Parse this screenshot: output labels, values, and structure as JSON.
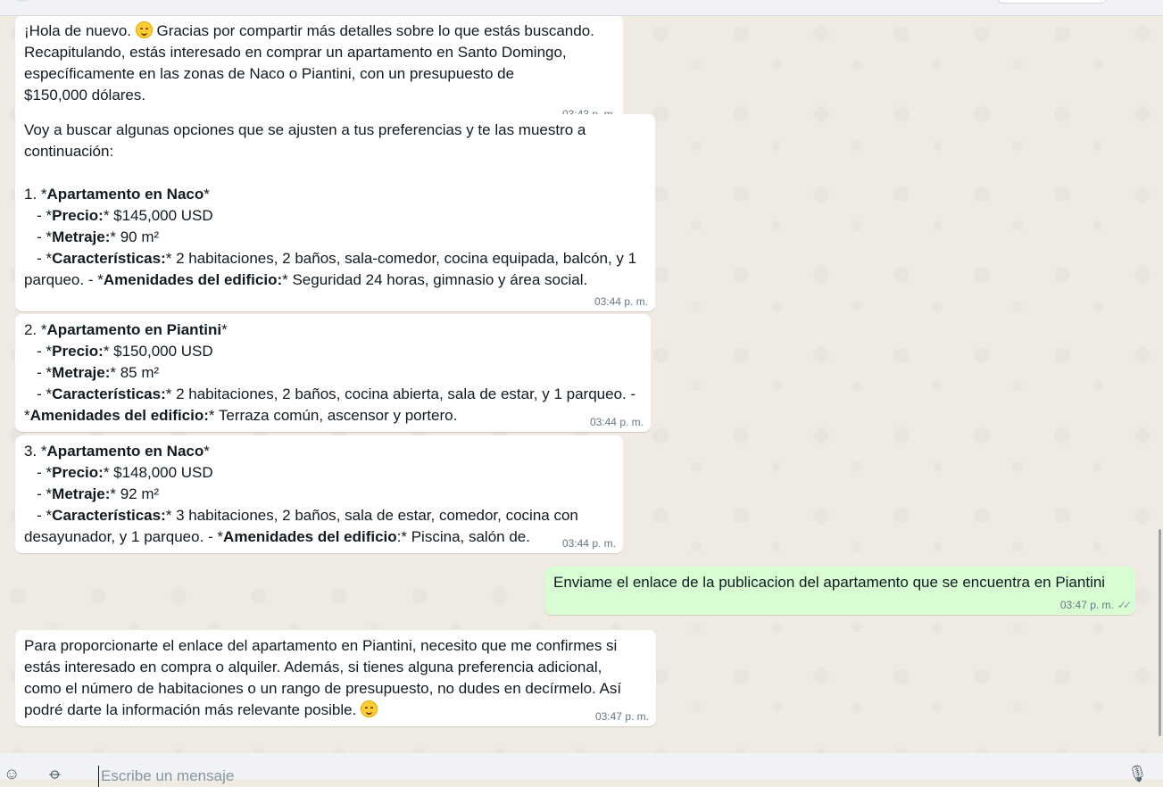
{
  "colors": {
    "chat_bg": "#efeae2",
    "incoming": "#ffffff",
    "outgoing": "#d9fdd3",
    "time": "#667781"
  },
  "messages": [
    {
      "lines": [
        [
          {
            "t": "¡Hola de nuevo. "
          },
          {
            "emoji": "smiling-face-emoji"
          },
          {
            "t": " Gracias por compartir más detalles sobre lo que estás buscando."
          }
        ],
        [
          {
            "t": "Recapitulando, estás interesado en comprar un apartamento en Santo Domingo,"
          }
        ],
        [
          {
            "t": "específicamente en las zonas de Naco o Piantini, con un presupuesto de"
          }
        ],
        [
          {
            "t": "$150,000 dólares."
          }
        ]
      ],
      "time": "03:43 p. m."
    },
    {
      "lines": [
        [
          {
            "t": "Voy a buscar algunas opciones que se ajusten a tus preferencias y te las muestro a"
          }
        ],
        [
          {
            "t": "continuación:"
          }
        ],
        [
          {
            "t": ""
          }
        ],
        [
          {
            "t": "1. *"
          },
          {
            "b": "Apartamento en Naco"
          },
          {
            "t": "*"
          }
        ],
        [
          {
            "t": "   - *"
          },
          {
            "b": "Precio:"
          },
          {
            "t": "* $145,000 USD"
          }
        ],
        [
          {
            "t": "   - *"
          },
          {
            "b": "Metraje:"
          },
          {
            "t": "* 90 m²"
          }
        ],
        [
          {
            "t": "   - *"
          },
          {
            "b": "Características:"
          },
          {
            "t": "* 2 habitaciones, 2 baños, sala-comedor, cocina equipada, balcón, y 1"
          }
        ],
        [
          {
            "t": "parqueo. - *"
          },
          {
            "b": "Amenidades del edificio:"
          },
          {
            "t": "* Seguridad 24 horas, gimnasio y área social."
          }
        ]
      ],
      "time": "03:44 p. m."
    },
    {
      "lines": [
        [
          {
            "t": "2. *"
          },
          {
            "b": "Apartamento en Piantini"
          },
          {
            "t": "*"
          }
        ],
        [
          {
            "t": "   - *"
          },
          {
            "b": "Precio:"
          },
          {
            "t": "* $150,000 USD"
          }
        ],
        [
          {
            "t": "   - *"
          },
          {
            "b": "Metraje:"
          },
          {
            "t": "* 85 m²"
          }
        ],
        [
          {
            "t": "   - *"
          },
          {
            "b": "Características:"
          },
          {
            "t": "* 2 habitaciones, 2 baños, cocina abierta, sala de estar, y 1 parqueo. -"
          }
        ],
        [
          {
            "t": "*"
          },
          {
            "b": "Amenidades del edificio:"
          },
          {
            "t": "* Terraza común, ascensor y portero."
          }
        ]
      ],
      "time": "03:44 p. m."
    },
    {
      "lines": [
        [
          {
            "t": "3. *"
          },
          {
            "b": "Apartamento en Naco"
          },
          {
            "t": "*"
          }
        ],
        [
          {
            "t": "   - *"
          },
          {
            "b": "Precio:"
          },
          {
            "t": "* $148,000 USD"
          }
        ],
        [
          {
            "t": "   - *"
          },
          {
            "b": "Metraje:"
          },
          {
            "t": "* 92 m²"
          }
        ],
        [
          {
            "t": "   - *"
          },
          {
            "b": "Características:"
          },
          {
            "t": "* 3 habitaciones, 2 baños, sala de estar, comedor, cocina con"
          }
        ],
        [
          {
            "t": "desayunador, y 1 parqueo. - *"
          },
          {
            "b": "Amenidades del edificio"
          },
          {
            "t": ":* Piscina, salón de."
          }
        ]
      ],
      "time": "03:44 p. m."
    },
    {
      "outgoing": true,
      "lines": [
        [
          {
            "t": "Enviame el enlace de la publicacion del apartamento que se encuentra en Piantini"
          }
        ]
      ],
      "time": "03:47 p. m.",
      "status_icon": "double-check-icon"
    },
    {
      "lines": [
        [
          {
            "t": "Para proporcionarte el enlace del apartamento en Piantini, necesito que me confirmes si"
          }
        ],
        [
          {
            "t": "estás interesado en compra o alquiler. Además, si tienes alguna preferencia adicional,"
          }
        ],
        [
          {
            "t": "como el número de habitaciones o un rango de presupuesto, no dudes en decírmelo. Así"
          }
        ],
        [
          {
            "t": "podré darte la información más relevante posible. "
          },
          {
            "emoji": "smiling-face-emoji"
          }
        ]
      ],
      "time": "03:47 p. m."
    }
  ],
  "composer": {
    "placeholder": "Escribe un mensaje",
    "emoji_icon": "emoji-icon",
    "attach_icon": "paperclip-icon",
    "mic_icon": "microphone-icon"
  }
}
